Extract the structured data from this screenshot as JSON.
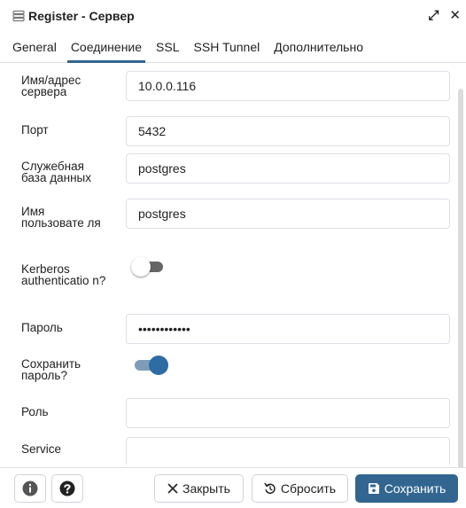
{
  "window": {
    "title": "Register - Сервер",
    "icon": "server-icon",
    "expand_icon": "expand-icon",
    "close_icon": "close-icon",
    "expand_glyph": "⤢",
    "close_glyph": "✕"
  },
  "tabs": [
    {
      "label": "General",
      "active": false
    },
    {
      "label": "Соединение",
      "active": true
    },
    {
      "label": "SSL",
      "active": false
    },
    {
      "label": "SSH Tunnel",
      "active": false
    },
    {
      "label": "Дополнительно",
      "active": false
    }
  ],
  "form": {
    "host": {
      "label": "Имя/адрес сервера",
      "value": "10.0.0.116"
    },
    "port": {
      "label": "Порт",
      "value": "5432"
    },
    "maintenance_db": {
      "label": "Служебная база данных",
      "value": "postgres"
    },
    "username": {
      "label": "Имя пользовате ля",
      "value": "postgres"
    },
    "kerberos": {
      "label": "Kerberos authenticatio n?",
      "enabled": false
    },
    "password": {
      "label": "Пароль",
      "value": "••••••••••••"
    },
    "save_password": {
      "label": "Сохранить пароль?",
      "enabled": true
    },
    "role": {
      "label": "Роль",
      "value": ""
    },
    "service": {
      "label": "Service",
      "value": ""
    }
  },
  "footer": {
    "info_icon": "info-icon",
    "help_icon": "help-icon",
    "close_label": "Закрыть",
    "reset_label": "Сбросить",
    "save_label": "Сохранить"
  },
  "colors": {
    "accent": "#326690",
    "toggle_on_knob": "#2e6ca4",
    "toggle_on_track": "#7e9cb8",
    "toggle_off_track": "#666666",
    "border": "#dde0e6"
  }
}
